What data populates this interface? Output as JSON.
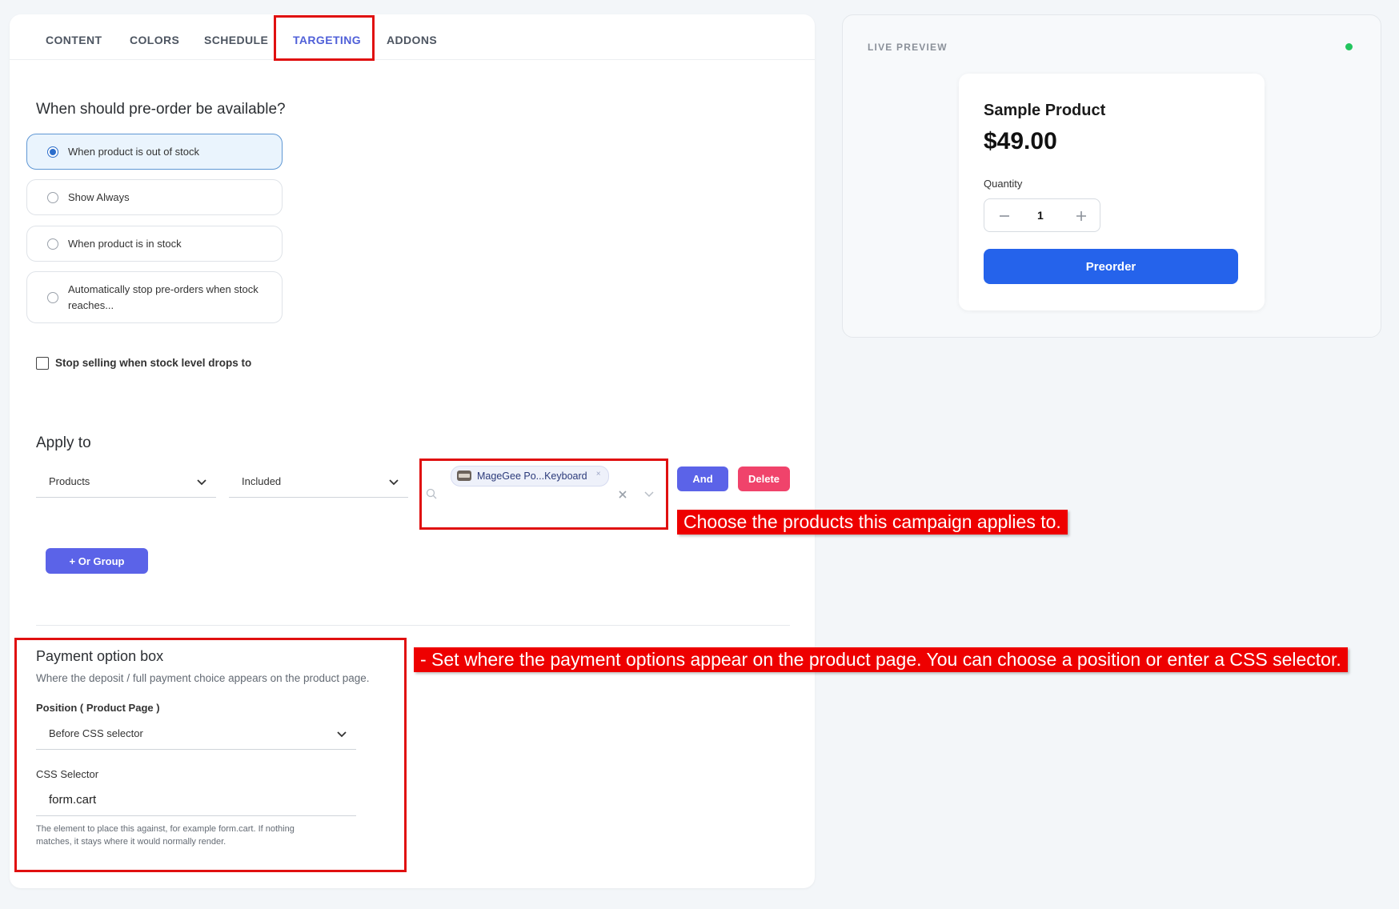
{
  "tabs": [
    {
      "label": "CONTENT"
    },
    {
      "label": "COLORS"
    },
    {
      "label": "SCHEDULE"
    },
    {
      "label": "TARGETING"
    },
    {
      "label": "ADDONS"
    }
  ],
  "availability": {
    "title": "When should pre-order be available?",
    "options": [
      {
        "label": "When product is out of stock",
        "selected": true
      },
      {
        "label": "Show Always",
        "selected": false
      },
      {
        "label": "When product is in stock",
        "selected": false
      },
      {
        "label": "Automatically stop pre-orders when stock reaches...",
        "selected": false
      }
    ],
    "stop_selling_label": "Stop selling when stock level drops to"
  },
  "apply_to": {
    "title": "Apply to",
    "type_select": "Products",
    "mode_select": "Included",
    "tag_label": "MageGee Po...Keyboard",
    "and_label": "And",
    "delete_label": "Delete",
    "or_group_label": "+ Or Group"
  },
  "payment_box": {
    "title": "Payment option box",
    "description": "Where the deposit / full payment choice appears on the product page.",
    "position_label": "Position ( Product Page )",
    "position_value": "Before CSS selector",
    "css_label": "CSS Selector",
    "css_value": "form.cart",
    "help_line1": "The element to place this against, for example form.cart. If nothing",
    "help_line2": "matches, it stays where it would normally render."
  },
  "annotations": {
    "products_note": "Choose the products this campaign applies to.",
    "payment_note": "- Set where the payment options appear on the product page. You can choose a position or enter a CSS selector."
  },
  "preview": {
    "heading": "LIVE PREVIEW",
    "product_name": "Sample Product",
    "price": "$49.00",
    "quantity_label": "Quantity",
    "quantity_value": "1",
    "preorder_label": "Preorder"
  },
  "colors": {
    "accent": "#5b63e8",
    "danger": "#f0436b",
    "primary_button": "#2563eb",
    "status_dot": "#22c55e",
    "highlight": "#e01010"
  },
  "icons": [
    "chevron-down-icon",
    "search-icon",
    "clear-icon",
    "close-icon",
    "minus-icon",
    "plus-icon",
    "product-thumbnail-icon"
  ]
}
